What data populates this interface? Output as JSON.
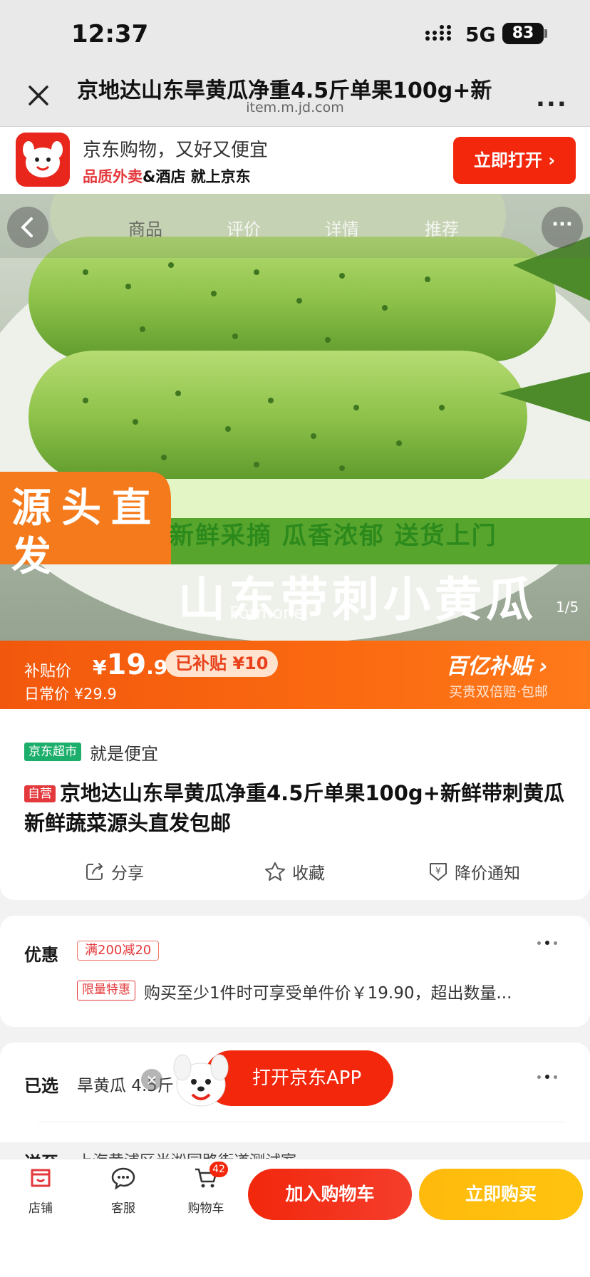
{
  "status_bar": {
    "time": "12:37",
    "network": "5G",
    "battery": "83"
  },
  "browser": {
    "page_title": "京地达山东旱黄瓜净重4.5斤单果100g+新",
    "domain": "item.m.jd.com",
    "more_label": "..."
  },
  "app_banner": {
    "line1": "京东购物，又好又便宜",
    "line2_red": "品质外卖",
    "line2_rest": "&酒店 就上京东",
    "open_button": "立即打开 ›"
  },
  "product_image": {
    "tabs": [
      "商品",
      "评价",
      "详情",
      "推荐"
    ],
    "more_label": "···",
    "counter": "1/5",
    "watermark": "Formone",
    "badge_corner": "源头直发",
    "banner_top": "新鲜采摘 瓜香浓郁 送货上门",
    "banner_main": "山东带刺小黄瓜"
  },
  "price": {
    "subsidy_label": "补贴价",
    "currency": "¥",
    "price_int": "19",
    "price_dec": ".90",
    "subsidy_badge": "已补贴 ¥10",
    "daily_price": "日常价 ¥29.9",
    "brand": "百亿补贴 ›",
    "brand_sub": "买贵双倍赔·包邮"
  },
  "info": {
    "supermarket_tag": "京东超市",
    "slogan": "就是便宜",
    "self_tag": "自营",
    "title": "京地达山东旱黄瓜净重4.5斤单果100g+新鲜带刺黄瓜新鲜蔬菜源头直发包邮",
    "actions": {
      "share": "分享",
      "favorite": "收藏",
      "price_alert": "降价通知"
    }
  },
  "promotions": {
    "title": "优惠",
    "coupon": "满200减20",
    "limited_tag": "限量特惠",
    "desc": "购买至少1件时可享受单件价￥19.90，超出数量..."
  },
  "selection": {
    "title": "已选",
    "value": "旱黄瓜 4.5斤 [",
    "ship_title": "送至",
    "ship_value": "上海黄浦区半淞园路街道测试室"
  },
  "float_app": {
    "label": "打开京东APP",
    "close": "×"
  },
  "bottom_bar": {
    "shop": "店铺",
    "service": "客服",
    "cart": "购物车",
    "cart_count": "42",
    "add_to_cart": "加入购物车",
    "buy_now": "立即购买"
  },
  "colors": {
    "jd_red": "#f2270c",
    "buy_yellow": "#ffc30e",
    "price_orange": "#fb6a11"
  }
}
